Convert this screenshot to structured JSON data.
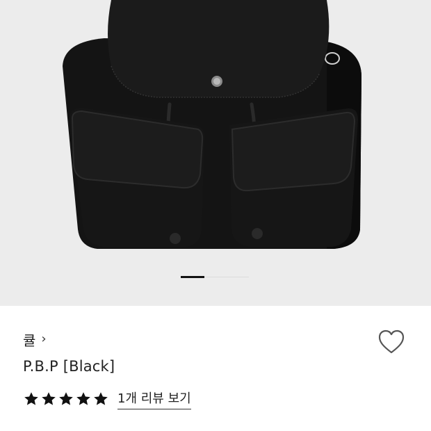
{
  "product_image": {
    "subject": "black canvas backpack",
    "background_color": "#ececec",
    "carousel": {
      "total_pages": 3,
      "active_page": 1
    }
  },
  "product": {
    "brand": "큘",
    "brand_chevron": "›",
    "name": "P.B.P [Black]"
  },
  "rating": {
    "stars": 5,
    "review_link_label": "1개 리뷰 보기"
  },
  "icons": {
    "wishlist": "heart-outline-icon",
    "star": "star-filled-icon",
    "brand_link": "chevron-right-icon"
  },
  "colors": {
    "bag": "#121212",
    "text": "#222222",
    "heart_stroke": "#555555"
  }
}
